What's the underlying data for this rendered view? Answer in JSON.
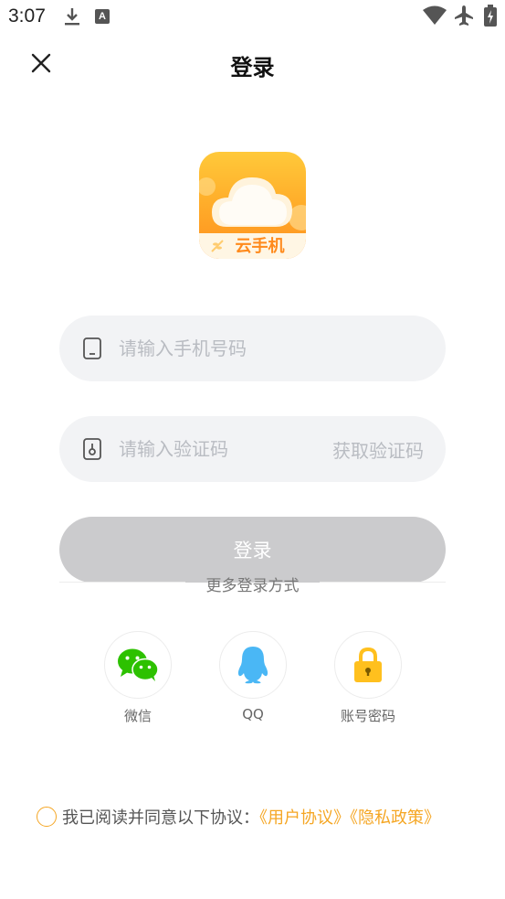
{
  "status_bar": {
    "time": "3:07",
    "icons": [
      "download-icon",
      "a-badge-icon",
      "wifi-icon",
      "airplane-mode-icon",
      "battery-charging-icon"
    ],
    "a_badge": "A"
  },
  "header": {
    "title": "登录",
    "close_icon": "close-icon"
  },
  "logo": {
    "text": "云手机",
    "colors": {
      "top": "#ffc93a",
      "bottom": "#ff8f1e",
      "band": "#fff6e4",
      "text": "#ff8a1c"
    }
  },
  "form": {
    "phone": {
      "placeholder": "请输入手机号码",
      "value": "",
      "icon": "phone-icon"
    },
    "code": {
      "placeholder": "请输入验证码",
      "value": "",
      "icon": "lock-code-icon",
      "get_code_label": "获取验证码"
    },
    "login_label": "登录"
  },
  "more_login": {
    "label": "更多登录方式",
    "methods": [
      {
        "label": "微信",
        "icon": "wechat-icon",
        "color": "#2dc100"
      },
      {
        "label": "QQ",
        "icon": "qq-icon",
        "color": "#4ab7f5"
      },
      {
        "label": "账号密码",
        "icon": "padlock-icon",
        "color": "#ffc01e"
      }
    ]
  },
  "agreement": {
    "text": "我已阅读并同意以下协议：",
    "user_agreement": "《用户协议》",
    "privacy_policy": "《隐私政策》",
    "accent": "#f5a623"
  },
  "colors": {
    "accent": "#f5a623",
    "field_bg": "#f2f3f5",
    "button_disabled": "#cbcbcd",
    "placeholder": "#b9bcc2"
  }
}
